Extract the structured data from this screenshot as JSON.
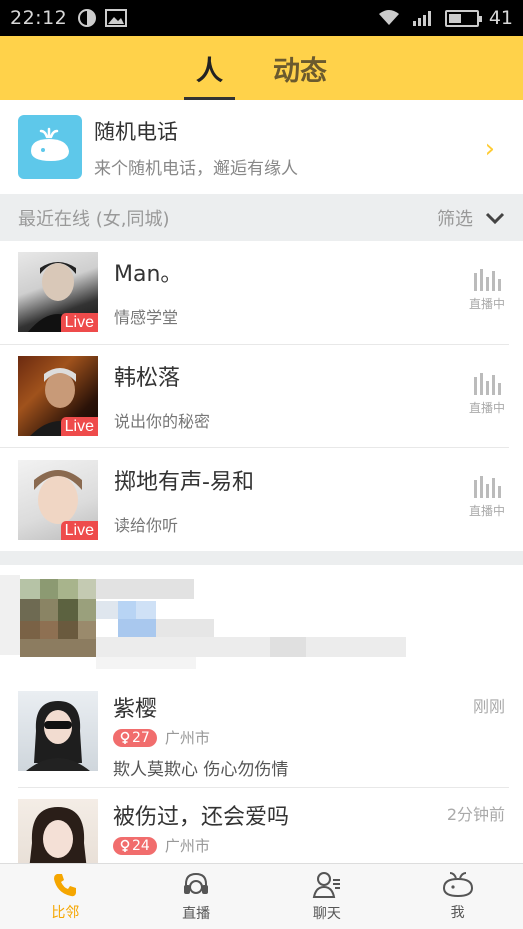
{
  "statusbar": {
    "time": "22:12",
    "battery": "41"
  },
  "header": {
    "tabs": [
      {
        "label": "人",
        "active": true
      },
      {
        "label": "动态",
        "active": false
      }
    ]
  },
  "random_call": {
    "title": "随机电话",
    "subtitle": "来个随机电话，邂逅有缘人"
  },
  "section": {
    "title": "最近在线 (女,同城)",
    "filter": "筛选"
  },
  "live_users": [
    {
      "name": "Man。",
      "desc": "情感学堂",
      "badge": "Live",
      "status": "直播中"
    },
    {
      "name": "韩松落",
      "desc": "说出你的秘密",
      "badge": "Live",
      "status": "直播中"
    },
    {
      "name": "掷地有声-易和",
      "desc": "读给你听",
      "badge": "Live",
      "status": "直播中"
    }
  ],
  "nearby_users": [
    {
      "name": "紫樱",
      "time": "刚刚",
      "age": "27",
      "city": "广州市",
      "signature": "欺人莫欺心 伤心勿伤情"
    },
    {
      "name": "被伤过，还会爱吗",
      "time": "2分钟前",
      "age": "24",
      "city": "广州市",
      "signature": ""
    }
  ],
  "tabbar": [
    {
      "label": "比邻",
      "icon": "phone-icon",
      "active": true
    },
    {
      "label": "直播",
      "icon": "headset-icon",
      "active": false
    },
    {
      "label": "聊天",
      "icon": "chat-person-icon",
      "active": false
    },
    {
      "label": "我",
      "icon": "whale-icon",
      "active": false
    }
  ],
  "colors": {
    "accent": "#ffd24a",
    "live": "#ee4b4b",
    "age": "#f16d6d",
    "tab_active": "#f5a600"
  }
}
